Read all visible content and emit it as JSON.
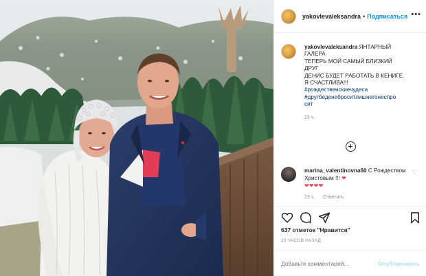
{
  "post": {
    "username": "yakovlevaleksandra",
    "follow_label": "Подписаться",
    "more_icon": "more-dots-icon",
    "caption_lines": [
      "ЯНТАРНЫЙ",
      "ГАЛЕРА",
      "ТЕПЕРЬ МОЙ САМЫЙ БЛИЗКИЙ",
      "ДРУГ",
      "ДЕНИС БУДЕТ РАБОТАТЬ В КЕНИГЕ.",
      "Я СЧАСТЛИВА!!!"
    ],
    "hashtags": [
      "#рождественскиечудеса",
      "#другбеденеброситлишнегонеспро",
      "сит"
    ],
    "caption_time": "23 ч.",
    "load_more_icon": "plus-circle-icon"
  },
  "comment": {
    "username": "marina_valentinovna60",
    "text": "С Рождеством Христовым !!!",
    "heart": "❤",
    "hearts_line": "❤❤❤❤",
    "time": "23 ч.",
    "reply_label": "Ответить",
    "like_icon": "heart-outline-icon"
  },
  "actions": {
    "icons": [
      "heart-outline-icon",
      "comment-icon",
      "share-icon",
      "bookmark-icon"
    ]
  },
  "likes_text": "637 отметок \"Нравится\"",
  "date_text": "23 ЧАСОВ НАЗАД",
  "add_comment": {
    "placeholder": "Добавьте комментарий...",
    "publish_label": "Опубликовать"
  }
}
